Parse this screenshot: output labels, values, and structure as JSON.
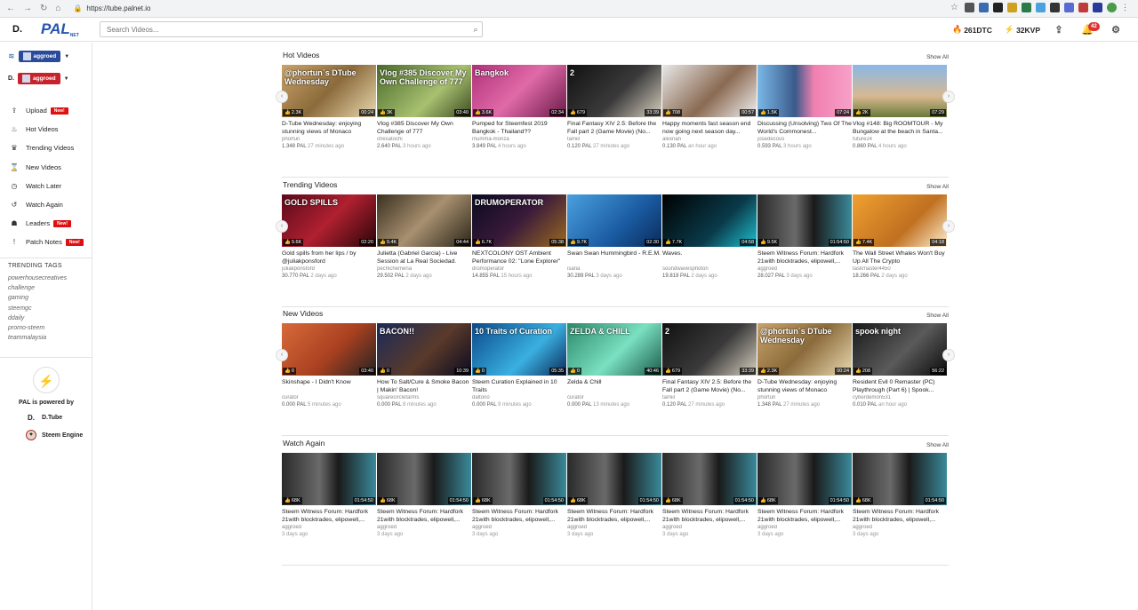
{
  "browser": {
    "url": "https://tube.palnet.io"
  },
  "header": {
    "logo_d": "D.",
    "logo_pal": "PAL",
    "logo_sub": "NET",
    "search_placeholder": "Search Videos...",
    "balance_dtc": "261DTC",
    "balance_kvp": "32KVP",
    "notif_count": "42"
  },
  "sidebar": {
    "accounts": [
      {
        "name": "aggroed",
        "network": "steemit"
      },
      {
        "name": "aggroed",
        "network": "dtube"
      }
    ],
    "menu": [
      {
        "label": "Upload",
        "new": "New!",
        "icon": "upload-icon"
      },
      {
        "label": "Hot Videos",
        "new": "",
        "icon": "flame-icon"
      },
      {
        "label": "Trending Videos",
        "new": "",
        "icon": "trophy-icon"
      },
      {
        "label": "New Videos",
        "new": "",
        "icon": "hourglass-icon"
      },
      {
        "label": "Watch Later",
        "new": "",
        "icon": "clock-icon"
      },
      {
        "label": "Watch Again",
        "new": "",
        "icon": "history-icon"
      },
      {
        "label": "Leaders",
        "new": "New!",
        "icon": "group-icon"
      },
      {
        "label": "Patch Notes",
        "new": "New!",
        "icon": "exclamation-icon"
      }
    ],
    "tags_title": "TRENDING TAGS",
    "tags": [
      "powerhousecreatives",
      "challenge",
      "gaming",
      "steemgc",
      "ddaily",
      "promo-steem",
      "teammalaysia"
    ],
    "powered_by": "PAL is powered by",
    "powered": [
      {
        "name": "D.Tube",
        "icon": "dtube-icon"
      },
      {
        "name": "Steem Engine",
        "icon": "steem-engine-icon"
      }
    ]
  },
  "show_all": "Show All",
  "sections": [
    {
      "title": "Hot Videos",
      "videos": [
        {
          "title": "D-Tube Wednesday: enjoying stunning views of Monaco",
          "author": "phortun",
          "pal": "1.348 PAL",
          "ago": "27 minutes ago",
          "votes": "2.3K",
          "dur": "00:24",
          "overlay": "@phortun´s DTube Wednesday",
          "bg": "linear-gradient(135deg,#c9a36a,#8b6b3b 50%,#e9d9b0)"
        },
        {
          "title": "Vlog #385 Discover My Own Challenge of 777",
          "author": "chesatochi",
          "pal": "2.640 PAL",
          "ago": "3 hours ago",
          "votes": "3K",
          "dur": "03:40",
          "overlay": "Vlog #385 Discover My Own Challenge of 777",
          "bg": "linear-gradient(135deg,#4a6b2a,#a8c070 60%,#3c4a22)"
        },
        {
          "title": "Pumped for Steemfest 2019 Bangkok - Thailand??",
          "author": "mumma-monza",
          "pal": "3.849 PAL",
          "ago": "4 hours ago",
          "votes": "3.6K",
          "dur": "02:34",
          "overlay": "Bangkok",
          "bg": "linear-gradient(135deg,#b0307a,#e06aa8 50%,#6a1a48)"
        },
        {
          "title": "Final Fantasy XIV 2.5: Before the Fall part 2 (Game Movie) (No...",
          "author": "tamiil",
          "pal": "0.120 PAL",
          "ago": "27 minutes ago",
          "votes": "679",
          "dur": "33:39",
          "overlay": "2",
          "bg": "linear-gradient(135deg,#111,#3a3a3a 55%,#d8d0c0)"
        },
        {
          "title": "Happy moments fast season end now going next season day...",
          "author": "alexnan",
          "pal": "0.130 PAL",
          "ago": "an hour ago",
          "votes": "708",
          "dur": "00:57",
          "overlay": "",
          "bg": "linear-gradient(135deg,#e8e8e8,#8a6a52 55%,#f2f2f2)"
        },
        {
          "title": "Discussing (Unsolving) Two Of The World's Commonest...",
          "author": "josedecous",
          "pal": "0.593 PAL",
          "ago": "3 hours ago",
          "votes": "1.5K",
          "dur": "07:24",
          "overlay": "",
          "bg": "linear-gradient(90deg,#7ab8e8,#3a5a8a 40%,#f080b0 60%,#f7a0c8)"
        },
        {
          "title": "Vlog #148: Big ROOMTOUR - My Bungalow at the beach in Santa...",
          "author": "future24",
          "pal": "0.860 PAL",
          "ago": "4 hours ago",
          "votes": "2K",
          "dur": "07:29",
          "overlay": "",
          "bg": "linear-gradient(180deg,#8ab8e8,#d8b890 60%,#6a7a3a)"
        }
      ]
    },
    {
      "title": "Trending Videos",
      "videos": [
        {
          "title": "Gold spills from her lips / by @juliakponsford",
          "author": "juliakponsford",
          "pal": "30.770 PAL",
          "ago": "2 days ago",
          "votes": "9.6K",
          "dur": "02:20",
          "overlay": "GOLD SPILLS",
          "bg": "linear-gradient(135deg,#5a0a1a,#b02030 50%,#2a0508)"
        },
        {
          "title": "Julietta (Gabriel Garcia) - Live Session at La Real Sociedad.",
          "author": "pechichemena",
          "pal": "29.502 PAL",
          "ago": "2 days ago",
          "votes": "9.4K",
          "dur": "04:44",
          "overlay": "",
          "bg": "linear-gradient(135deg,#3a3020,#a89070 50%,#2a2418)"
        },
        {
          "title": "NEXTCOLONY OST Ambient Performance 02: \"Lone Explorer\"",
          "author": "drumoperator",
          "pal": "14.855 PAL",
          "ago": "15 hours ago",
          "votes": "6.7K",
          "dur": "05:38",
          "overlay": "DRUMOPERATOR",
          "bg": "linear-gradient(135deg,#0a0a20,#3a1a3a 50%,#9a6a20)"
        },
        {
          "title": "Swan Swan Hummingbird - R.E.M.",
          "author": "isaria",
          "pal": "30.289 PAL",
          "ago": "3 days ago",
          "votes": "9.7K",
          "dur": "02:30",
          "overlay": "",
          "bg": "linear-gradient(135deg,#4aa0e0,#1a5aa0 60%,#0a2a5a)"
        },
        {
          "title": "Waves.",
          "author": "soundwavesphoton",
          "pal": "19.819 PAL",
          "ago": "2 days ago",
          "votes": "7.7K",
          "dur": "04:58",
          "overlay": "",
          "bg": "linear-gradient(135deg,#000,#0a3a4a 60%,#20c0d0)"
        },
        {
          "title": "Steem Witness Forum: Hardfork 21with blocktrades, elipowell,...",
          "author": "aggroed",
          "pal": "28.027 PAL",
          "ago": "3 days ago",
          "votes": "9.5K",
          "dur": "01:54:50",
          "overlay": "",
          "bg": "linear-gradient(90deg,#2a2a2a,#6a6a6a 40%,#1a1a1a 60%,#3a8a9a)"
        },
        {
          "title": "The Wall Street Whales Won't Buy Up All The Crypto",
          "author": "taskmaster4450",
          "pal": "18.266 PAL",
          "ago": "2 days ago",
          "votes": "7.4K",
          "dur": "04:18",
          "overlay": "",
          "bg": "linear-gradient(135deg,#f0a030,#c07020 60%,#fff0d0)"
        }
      ]
    },
    {
      "title": "New Videos",
      "videos": [
        {
          "title": "Skinshape - I Didn't Know",
          "author": "curator",
          "pal": "0.000 PAL",
          "ago": "5 minutes ago",
          "votes": "0",
          "dur": "03:40",
          "overlay": "",
          "bg": "linear-gradient(135deg,#d86a3a,#a84020 55%,#222)"
        },
        {
          "title": "How To Salt/Cure & Smoke Bacon | Makin' Bacon!",
          "author": "squarecirclefarms",
          "pal": "0.000 PAL",
          "ago": "8 minutes ago",
          "votes": "0",
          "dur": "10:39",
          "overlay": "BACON!!",
          "bg": "linear-gradient(135deg,#1a2a5a,#5a3a2a 55%,#0a0a20)"
        },
        {
          "title": "Steem Curation Explained in 10 Traits",
          "author": "daltono",
          "pal": "0.000 PAL",
          "ago": "9 minutes ago",
          "votes": "0",
          "dur": "05:35",
          "overlay": "10 Traits of Curation",
          "bg": "linear-gradient(135deg,#0a4a8a,#3ab0e0 60%,#0a2a5a)"
        },
        {
          "title": "Zelda & Chill",
          "author": "curator",
          "pal": "0.000 PAL",
          "ago": "13 minutes ago",
          "votes": "0",
          "dur": "40:46",
          "overlay": "ZELDA & CHILL",
          "bg": "linear-gradient(135deg,#2a8a6a,#7ae0c0 55%,#1a5a4a)"
        },
        {
          "title": "Final Fantasy XIV 2.5: Before the Fall part 2 (Game Movie) (No...",
          "author": "tamiil",
          "pal": "0.120 PAL",
          "ago": "27 minutes ago",
          "votes": "679",
          "dur": "33:39",
          "overlay": "2",
          "bg": "linear-gradient(135deg,#111,#3a3a3a 55%,#d8d0c0)"
        },
        {
          "title": "D-Tube Wednesday: enjoying stunning views of Monaco",
          "author": "phortun",
          "pal": "1.348 PAL",
          "ago": "27 minutes ago",
          "votes": "2.3K",
          "dur": "00:24",
          "overlay": "@phortun´s DTube Wednesday",
          "bg": "linear-gradient(135deg,#c9a36a,#8b6b3b 50%,#e9d9b0)"
        },
        {
          "title": "Resident Evil 0 Remaster (PC) Playthrough (Part 6) | Spook...",
          "author": "cyberdemon531",
          "pal": "0.010 PAL",
          "ago": "an hour ago",
          "votes": "208",
          "dur": "56:22",
          "overlay": "spook night",
          "bg": "linear-gradient(135deg,#1a1a1a,#5a5a5a 55%,#0a0a0a)"
        }
      ]
    },
    {
      "title": "Watch Again",
      "videos": [
        {
          "title": "Steem Witness Forum: Hardfork 21with blocktrades, elipowell,...",
          "author": "aggroed",
          "pal": "",
          "ago": "3 days ago",
          "votes": "68K",
          "dur": "01:54:50",
          "overlay": "",
          "bg": "linear-gradient(90deg,#2a2a2a,#6a6a6a 40%,#1a1a1a 60%,#3a8a9a)"
        },
        {
          "title": "Steem Witness Forum: Hardfork 21with blocktrades, elipowell,...",
          "author": "aggroed",
          "pal": "",
          "ago": "3 days ago",
          "votes": "68K",
          "dur": "01:54:50",
          "overlay": "",
          "bg": "linear-gradient(90deg,#2a2a2a,#6a6a6a 40%,#1a1a1a 60%,#3a8a9a)"
        },
        {
          "title": "Steem Witness Forum: Hardfork 21with blocktrades, elipowell,...",
          "author": "aggroed",
          "pal": "",
          "ago": "3 days ago",
          "votes": "68K",
          "dur": "01:54:50",
          "overlay": "",
          "bg": "linear-gradient(90deg,#2a2a2a,#6a6a6a 40%,#1a1a1a 60%,#3a8a9a)"
        },
        {
          "title": "Steem Witness Forum: Hardfork 21with blocktrades, elipowell,...",
          "author": "aggroed",
          "pal": "",
          "ago": "3 days ago",
          "votes": "68K",
          "dur": "01:54:50",
          "overlay": "",
          "bg": "linear-gradient(90deg,#2a2a2a,#6a6a6a 40%,#1a1a1a 60%,#3a8a9a)"
        },
        {
          "title": "Steem Witness Forum: Hardfork 21with blocktrades, elipowell,...",
          "author": "aggroed",
          "pal": "",
          "ago": "3 days ago",
          "votes": "68K",
          "dur": "01:54:50",
          "overlay": "",
          "bg": "linear-gradient(90deg,#2a2a2a,#6a6a6a 40%,#1a1a1a 60%,#3a8a9a)"
        },
        {
          "title": "Steem Witness Forum: Hardfork 21with blocktrades, elipowell,...",
          "author": "aggroed",
          "pal": "",
          "ago": "3 days ago",
          "votes": "68K",
          "dur": "01:54:50",
          "overlay": "",
          "bg": "linear-gradient(90deg,#2a2a2a,#6a6a6a 40%,#1a1a1a 60%,#3a8a9a)"
        },
        {
          "title": "Steem Witness Forum: Hardfork 21with blocktrades, elipowell,...",
          "author": "aggroed",
          "pal": "",
          "ago": "3 days ago",
          "votes": "68K",
          "dur": "01:54:50",
          "overlay": "",
          "bg": "linear-gradient(90deg,#2a2a2a,#6a6a6a 40%,#1a1a1a 60%,#3a8a9a)"
        }
      ]
    }
  ]
}
